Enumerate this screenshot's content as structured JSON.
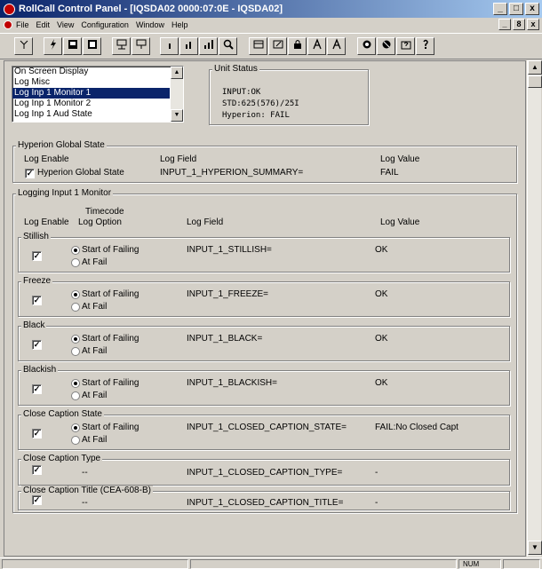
{
  "window": {
    "title": "RollCall Control Panel - [IQSDA02 0000:07:0E - IQSDA02]",
    "minimize": "_",
    "maximize": "□",
    "close": "x"
  },
  "menu": {
    "items": [
      "File",
      "Edit",
      "View",
      "Configuration",
      "Window",
      "Help"
    ],
    "mdi_min": "_",
    "mdi_restore": "8",
    "mdi_close": "x"
  },
  "toolbar": {
    "icons": [
      "connect-icon",
      "lightning-icon",
      "config-icon",
      "monitor-icon",
      "network-icon",
      "network2-icon",
      "bar-chart-icon",
      "bar-chart2-icon",
      "bar-chart3-icon",
      "search-icon",
      "panel-icon",
      "edit-icon",
      "lock-icon",
      "font-a-icon",
      "font-a2-icon",
      "log-icon",
      "log2-icon",
      "question-icon",
      "help-icon"
    ]
  },
  "list": {
    "items": [
      "On Screen Display",
      "Log Misc",
      "Log Inp 1 Monitor 1",
      "Log Inp 1 Monitor 2",
      "Log Inp 1 Aud State"
    ],
    "selected_index": 2,
    "up_arrow": "▲",
    "down_arrow": "▼"
  },
  "unit_status": {
    "label": "Unit Status",
    "lines": [
      "INPUT:OK",
      "STD:625(576)/25I",
      "Hyperion: FAIL"
    ]
  },
  "hyperion": {
    "group_label": "Hyperion Global State",
    "col_enable": "Log Enable",
    "col_field": "Log Field",
    "col_value": "Log Value",
    "checkbox_label": "Hyperion Global State",
    "field": "INPUT_1_HYPERION_SUMMARY=",
    "value": "FAIL"
  },
  "logging": {
    "group_label": "Logging Input 1 Monitor",
    "col_enable": "Log Enable",
    "col_timecode_1": "Timecode",
    "col_timecode_2": "Log Option",
    "col_field": "Log Field",
    "col_value": "Log Value",
    "rows": [
      {
        "label": "Stillish",
        "opt1": "Start of Failing",
        "opt2": "At Fail",
        "field": "INPUT_1_STILLISH=",
        "value": "OK"
      },
      {
        "label": "Freeze",
        "opt1": "Start of Failing",
        "opt2": "At Fail",
        "field": "INPUT_1_FREEZE=",
        "value": "OK"
      },
      {
        "label": "Black",
        "opt1": "Start of Failing",
        "opt2": "At Fail",
        "field": "INPUT_1_BLACK=",
        "value": "OK"
      },
      {
        "label": "Blackish",
        "opt1": "Start of Failing",
        "opt2": "At Fail",
        "field": "INPUT_1_BLACKISH=",
        "value": "OK"
      },
      {
        "label": "Close Caption State",
        "opt1": "Start of Failing",
        "opt2": "At Fail",
        "field": "INPUT_1_CLOSED_CAPTION_STATE=",
        "value": "FAIL:No Closed Capt"
      },
      {
        "label": "Close Caption Type",
        "dash": "--",
        "field": "INPUT_1_CLOSED_CAPTION_TYPE=",
        "value": "-"
      },
      {
        "label": "Close Caption Title (CEA-608-B)",
        "dash": "--",
        "field": "INPUT_1_CLOSED_CAPTION_TITLE=",
        "value": "-"
      }
    ]
  },
  "check_mark": "✓",
  "scroll": {
    "up": "▲",
    "down": "▼"
  },
  "statusbar": {
    "num": "NUM"
  }
}
